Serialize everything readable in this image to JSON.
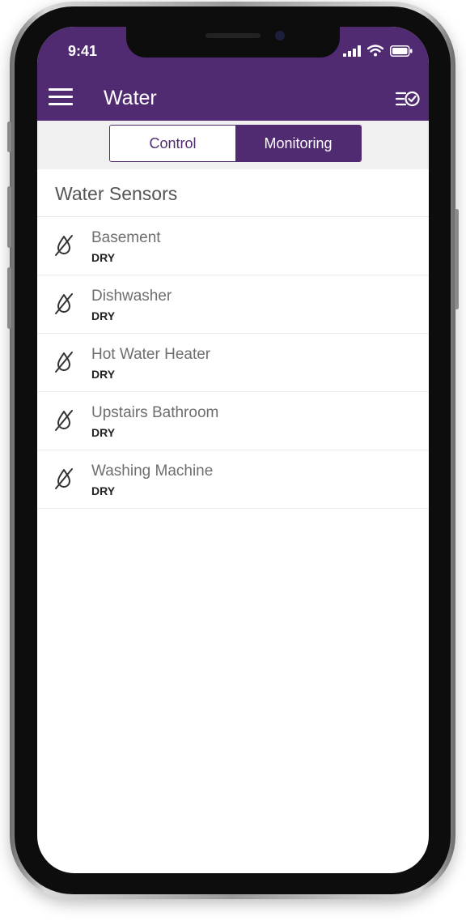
{
  "status_bar": {
    "time": "9:41"
  },
  "app_bar": {
    "title": "Water"
  },
  "tabs": [
    {
      "label": "Control",
      "active": false
    },
    {
      "label": "Monitoring",
      "active": true
    }
  ],
  "section": {
    "title": "Water Sensors"
  },
  "sensors": [
    {
      "name": "Basement",
      "status": "DRY",
      "icon": "water-drop-off-icon"
    },
    {
      "name": "Dishwasher",
      "status": "DRY",
      "icon": "water-drop-off-icon"
    },
    {
      "name": "Hot Water Heater",
      "status": "DRY",
      "icon": "water-drop-off-icon"
    },
    {
      "name": "Upstairs Bathroom",
      "status": "DRY",
      "icon": "water-drop-off-icon"
    },
    {
      "name": "Washing Machine",
      "status": "DRY",
      "icon": "water-drop-off-icon"
    }
  ],
  "colors": {
    "brand": "#512b72",
    "background": "#ffffff",
    "segment_bg": "#f0f0f0"
  }
}
